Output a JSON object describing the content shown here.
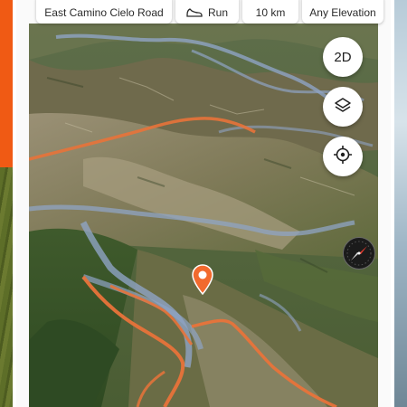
{
  "filters": {
    "location": "East Camino Cielo Road",
    "activity": {
      "label": "Run",
      "icon": "shoe-icon"
    },
    "distance": "10 km",
    "elevation": "Any Elevation"
  },
  "map_controls": {
    "view_mode": "2D",
    "layers_icon": "layers-icon",
    "locate_icon": "crosshair-icon",
    "compass_icon": "compass-icon"
  },
  "map": {
    "pin_icon": "location-pin-icon",
    "colors": {
      "route": "#e8733a",
      "trail": "#8fa4c4",
      "pin": "#f26a2e",
      "terrain": "#4f6a35"
    }
  }
}
